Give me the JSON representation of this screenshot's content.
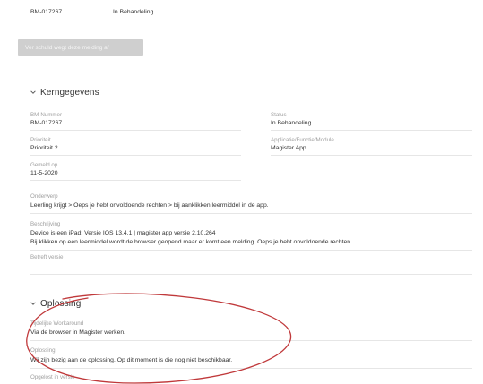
{
  "header": {
    "ticket_id": "BM-017267",
    "status": "In Behandeling"
  },
  "action_button": {
    "label": "Ver schuld wegt deze melding af"
  },
  "kerngegevens": {
    "title": "Kerngegevens",
    "fields": [
      {
        "label": "BM-Nummer",
        "value": "BM-017267"
      },
      {
        "label": "Status",
        "value": "In Behandeling"
      },
      {
        "label": "Prioriteit",
        "value": "Prioriteit 2"
      },
      {
        "label": "Applicatie/Functie/Module",
        "value": "Magister App"
      },
      {
        "label": "Gemeld op",
        "value": "11-5-2020"
      },
      {
        "label": "Onderwerp",
        "value": "Leerling krijgt > Oeps je hebt onvoldoende rechten > bij aanklikken leermiddel in de app."
      },
      {
        "label": "Beschrijving",
        "value_line1": "Device is een iPad: Versie IOS 13.4.1 | magister app versie 2.10.264",
        "value_line2": "Bij klikken op een leermiddel wordt de browser geopend maar er komt een melding. Oeps je hebt onvoldoende rechten."
      },
      {
        "label": "Betreft versie",
        "value": ""
      }
    ]
  },
  "oplossing": {
    "title": "Oplossing",
    "fields": [
      {
        "label": "Tijdelijke Workaround",
        "value": "Via de browser in Magister werken."
      },
      {
        "label": "Oplossing",
        "value": "Wij zijn bezig aan de oplossing. Op dit moment is die nog niet beschikbaar."
      },
      {
        "label": "Opgelost in versie",
        "value": ""
      }
    ]
  },
  "colors": {
    "annotation": "#c0393b",
    "button_bg": "#cfcfcf",
    "divider": "#e6e6e6"
  }
}
